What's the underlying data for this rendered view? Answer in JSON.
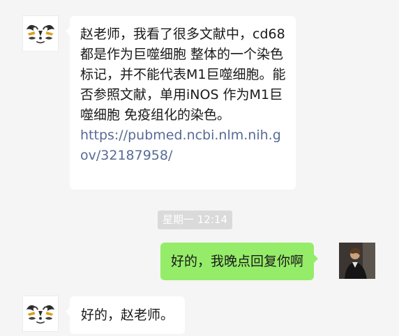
{
  "chat": {
    "messages": [
      {
        "sender": "contact",
        "avatar_icon": "stylized-face-logo-icon",
        "text": "赵老师，我看了很多文献中，cd68 都是作为巨噬细胞 整体的一个染色标记，并不能代表M1巨噬细胞。能否参照文献，单用iNOS 作为M1巨噬细胞 免疫组化的染色。",
        "link": "https://pubmed.ncbi.nlm.nih.gov/32187958/"
      },
      {
        "sender": "self",
        "avatar_icon": "user-photo-icon",
        "text": "好的，我晚点回复你啊"
      },
      {
        "sender": "contact",
        "avatar_icon": "stylized-face-logo-icon",
        "text": "好的，赵老师。"
      }
    ],
    "timestamp": "星期一 12:14"
  },
  "colors": {
    "background": "#f5f5f5",
    "incoming_bubble": "#ffffff",
    "outgoing_bubble": "#95ec69",
    "link": "#576b95",
    "timestamp_bg": "#dadada",
    "text": "#191919"
  }
}
